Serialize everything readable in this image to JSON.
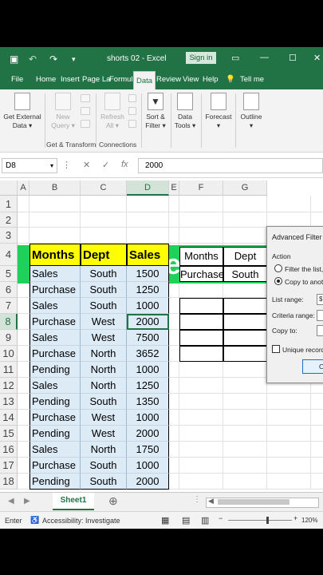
{
  "titlebar": {
    "title": "shorts 02  -  Excel",
    "signin": "Sign in"
  },
  "tabs": [
    "File",
    "Home",
    "Insert",
    "Page La",
    "Formul",
    "Data",
    "Review",
    "View",
    "Help",
    "Tell me"
  ],
  "ribbon": {
    "get_external": "Get External",
    "get_external2": "Data",
    "new_query": "New",
    "new_query2": "Query",
    "refresh": "Refresh",
    "refresh2": "All",
    "sort_filter": "Sort &",
    "sort_filter2": "Filter",
    "data_tools": "Data",
    "data_tools2": "Tools",
    "forecast": "Forecast",
    "outline": "Outline",
    "group1": "Get & Transform",
    "group2": "Connections"
  },
  "formula_bar": {
    "name_box": "D8",
    "fx": "fx",
    "value": "2000"
  },
  "columns": [
    "A",
    "B",
    "C",
    "D",
    "E",
    "F",
    "G"
  ],
  "rows": [
    "1",
    "2",
    "3",
    "4",
    "5",
    "6",
    "7",
    "8",
    "9",
    "10",
    "11",
    "12",
    "13",
    "14",
    "15",
    "16",
    "17",
    "18"
  ],
  "banner": "Advanced Filter",
  "table": {
    "headers": [
      "Months",
      "Dept",
      "Sales"
    ],
    "rows": [
      [
        "Sales",
        "South",
        "1500"
      ],
      [
        "Purchase",
        "South",
        "1250"
      ],
      [
        "Sales",
        "South",
        "1000"
      ],
      [
        "Purchase",
        "West",
        "2000"
      ],
      [
        "Sales",
        "West",
        "7500"
      ],
      [
        "Purchase",
        "North",
        "3652"
      ],
      [
        "Pending",
        "North",
        "1000"
      ],
      [
        "Sales",
        "North",
        "1250"
      ],
      [
        "Pending",
        "South",
        "1350"
      ],
      [
        "Purchase",
        "West",
        "1000"
      ],
      [
        "Pending",
        "West",
        "2000"
      ],
      [
        "Sales",
        "North",
        "1750"
      ],
      [
        "Purchase",
        "South",
        "1000"
      ],
      [
        "Pending",
        "South",
        "2000"
      ]
    ]
  },
  "criteria": {
    "headers": [
      "Months",
      "Dept"
    ],
    "values": [
      "Purchase",
      "South"
    ]
  },
  "dialog": {
    "title": "Advanced Filter",
    "action": "Action",
    "opt1": "Filter the list,",
    "opt2": "Copy to anot",
    "list_range": "List range:",
    "criteria_range": "Criteria range:",
    "copy_to": "Copy to:",
    "unique": "Unique records",
    "list_range_value": "$I",
    "ok": "O"
  },
  "sheet_tab": "Sheet1",
  "status": {
    "mode": "Enter",
    "accessibility": "Accessibility: Investigate",
    "zoom": "120%"
  },
  "colors": {
    "excel_green": "#217346",
    "banner_green": "#1fd15a",
    "header_yellow": "#ffff00",
    "data_blue": "#ddebf7"
  }
}
